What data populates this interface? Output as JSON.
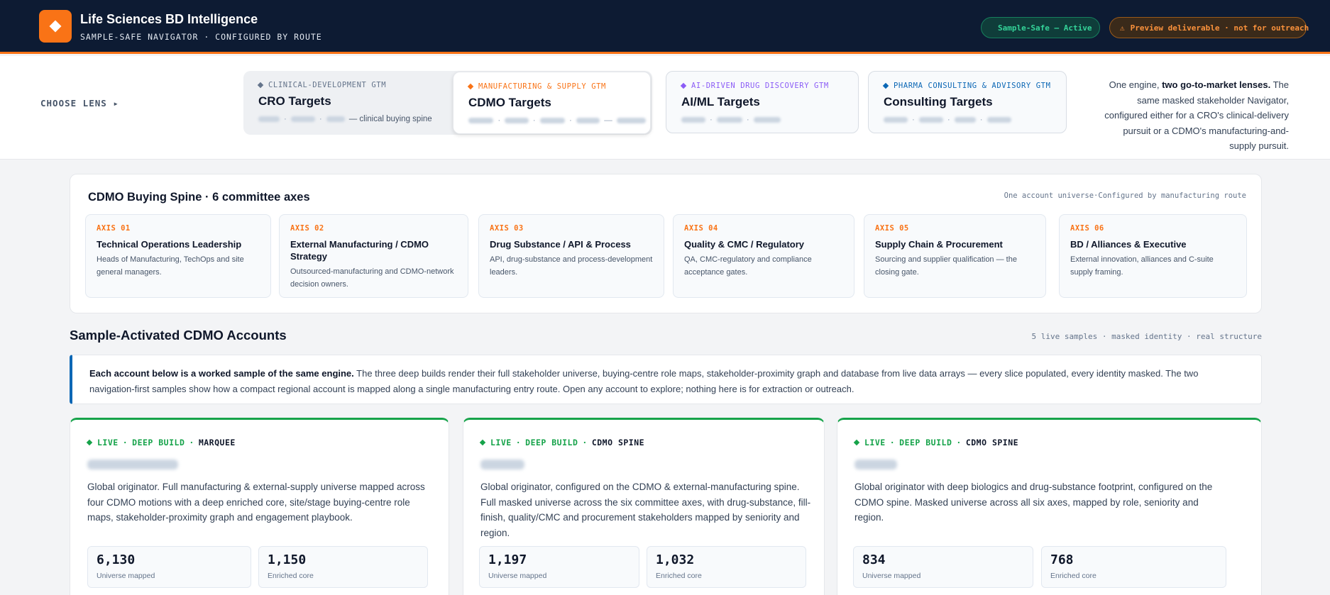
{
  "header": {
    "title": "Life Sciences BD Intelligence",
    "subtitle": "SAMPLE-SAFE NAVIGATOR · CONFIGURED BY ROUTE",
    "status_pill": "Sample-Safe – Active",
    "preview_pill": "Preview deliverable · not for outreach"
  },
  "lens_bar": {
    "choose_label": "CHOOSE LENS",
    "lenses": [
      {
        "tag": "CLINICAL-DEVELOPMENT GTM",
        "name": "CRO Targets",
        "desc_suffix": "— clinical buying spine",
        "color": "#64748b"
      },
      {
        "tag": "MANUFACTURING & SUPPLY GTM",
        "name": "CDMO Targets",
        "color": "#f97316"
      },
      {
        "tag": "AI-DRIVEN DRUG DISCOVERY GTM",
        "name": "AI/ML Targets",
        "color": "#8b5cf6"
      },
      {
        "tag": "PHARMA CONSULTING & ADVISORY GTM",
        "name": "Consulting Targets",
        "color": "#0b67b5"
      }
    ],
    "note_pre": "One engine, ",
    "note_bold": "two go-to-market lenses.",
    "note_post": " The same masked stakeholder Navigator, configured either for a CRO's clinical-delivery pursuit or a CDMO's manufacturing-and-supply pursuit."
  },
  "spine": {
    "title": "CDMO Buying Spine · 6 committee axes",
    "note": "One account universe·Configured by manufacturing route",
    "axes": [
      {
        "num": "AXIS 01",
        "title": "Technical Operations Leadership",
        "desc": "Heads of Manufacturing, TechOps and site general managers."
      },
      {
        "num": "AXIS 02",
        "title": "External Manufacturing / CDMO Strategy",
        "desc": "Outsourced-manufacturing and CDMO-network decision owners."
      },
      {
        "num": "AXIS 03",
        "title": "Drug Substance / API & Process",
        "desc": "API, drug-substance and process-development leaders."
      },
      {
        "num": "AXIS 04",
        "title": "Quality & CMC / Regulatory",
        "desc": "QA, CMC-regulatory and compliance acceptance gates."
      },
      {
        "num": "AXIS 05",
        "title": "Supply Chain & Procurement",
        "desc": "Sourcing and supplier qualification — the closing gate."
      },
      {
        "num": "AXIS 06",
        "title": "BD / Alliances & Executive",
        "desc": "External innovation, alliances and C-suite supply framing."
      }
    ]
  },
  "accounts": {
    "title": "Sample-Activated CDMO Accounts",
    "note": "5 live samples · masked identity · real structure",
    "info_bold": "Each account below is a worked sample of the same engine.",
    "info_text": " The three deep builds render their full stakeholder universe, buying-centre role maps, stakeholder-proximity graph and database from live data arrays — every slice populated, every identity masked. The two navigation-first samples show how a compact regional account is mapped along a single manufacturing entry route. Open any account to explore; nothing here is for extraction or outreach.",
    "cards": [
      {
        "live": "LIVE",
        "build": "DEEP BUILD",
        "kind": "MARQUEE",
        "desc": "Global originator. Full manufacturing & external-supply universe mapped across four CDMO motions with a deep enriched core, site/stage buying-centre role maps, stakeholder-proximity graph and engagement playbook.",
        "stat1_val": "6,130",
        "stat1_lbl": "Universe mapped",
        "stat2_val": "1,150",
        "stat2_lbl": "Enriched core"
      },
      {
        "live": "LIVE",
        "build": "DEEP BUILD",
        "kind": "CDMO SPINE",
        "desc": "Global originator, configured on the CDMO & external-manufacturing spine. Full masked universe across the six committee axes, with drug-substance, fill-finish, quality/CMC and procurement stakeholders mapped by seniority and region.",
        "stat1_val": "1,197",
        "stat1_lbl": "Universe mapped",
        "stat2_val": "1,032",
        "stat2_lbl": "Enriched core"
      },
      {
        "live": "LIVE",
        "build": "DEEP BUILD",
        "kind": "CDMO SPINE",
        "desc": "Global originator with deep biologics and drug-substance footprint, configured on the CDMO spine. Masked universe across all six axes, mapped by role, seniority and region.",
        "stat1_val": "834",
        "stat1_lbl": "Universe mapped",
        "stat2_val": "768",
        "stat2_lbl": "Enriched core"
      }
    ]
  }
}
